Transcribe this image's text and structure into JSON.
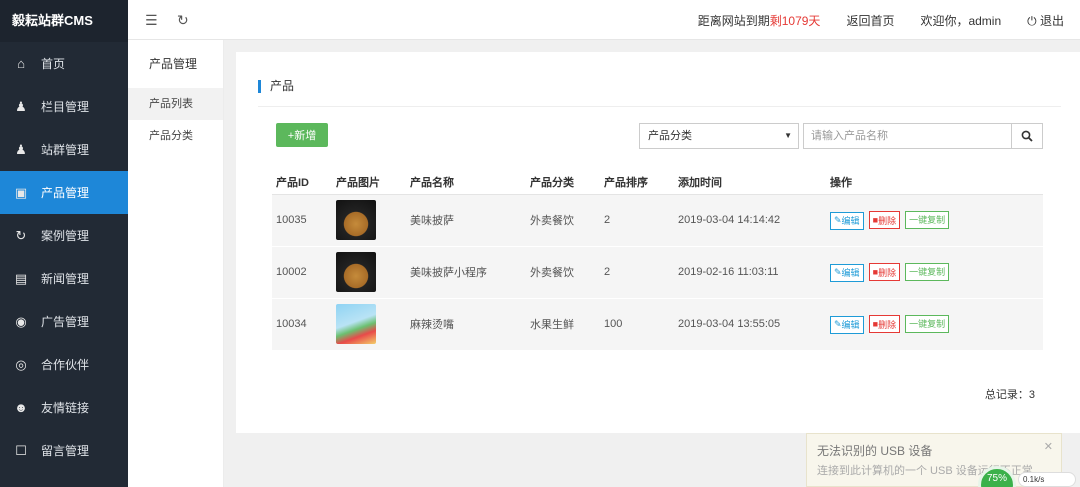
{
  "app": {
    "brand": "毅耘站群CMS"
  },
  "sidebar": {
    "items": [
      {
        "label": "首页",
        "icon": "home-icon"
      },
      {
        "label": "栏目管理",
        "icon": "user-gear-icon"
      },
      {
        "label": "站群管理",
        "icon": "user-gear-icon"
      },
      {
        "label": "产品管理",
        "icon": "gift-icon",
        "active": true
      },
      {
        "label": "案例管理",
        "icon": "refresh-icon"
      },
      {
        "label": "新闻管理",
        "icon": "news-icon"
      },
      {
        "label": "广告管理",
        "icon": "ad-icon"
      },
      {
        "label": "合作伙伴",
        "icon": "partner-icon"
      },
      {
        "label": "友情链接",
        "icon": "user-icon"
      },
      {
        "label": "留言管理",
        "icon": "message-icon"
      }
    ]
  },
  "topbar": {
    "expire_label": "距离网站到期",
    "expire_days": "剩1079天",
    "home_link": "返回首页",
    "welcome": "欢迎你，admin",
    "logout": "退出"
  },
  "submenu": {
    "title": "产品管理",
    "items": [
      {
        "label": "产品列表",
        "active": true
      },
      {
        "label": "产品分类"
      }
    ]
  },
  "panel": {
    "title": "产品",
    "add_button": "+新增",
    "category_select": "产品分类",
    "search_placeholder": "请输入产品名称",
    "total": "总记录：3"
  },
  "table": {
    "headers": [
      "产品ID",
      "产品图片",
      "产品名称",
      "产品分类",
      "产品排序",
      "添加时间",
      "操作"
    ],
    "rows": [
      {
        "id": "10035",
        "image": "pizza",
        "name": "美味披萨",
        "category": "外卖餐饮",
        "sort": "2",
        "time": "2019-03-04 14:14:42"
      },
      {
        "id": "10002",
        "image": "pizza",
        "name": "美味披萨小程序",
        "category": "外卖餐饮",
        "sort": "2",
        "time": "2019-02-16 11:03:11"
      },
      {
        "id": "10034",
        "image": "fruit",
        "name": "麻辣烫嘴",
        "category": "水果生鲜",
        "sort": "100",
        "time": "2019-03-04 13:55:05"
      }
    ],
    "actions": {
      "edit": "编辑",
      "delete": "删除",
      "copy": "一键复制"
    }
  },
  "notification": {
    "title": "无法识别的 USB 设备",
    "body": "连接到此计算机的一个 USB 设备运行不正常",
    "meter": "75%",
    "speed": "0.1k/s"
  }
}
